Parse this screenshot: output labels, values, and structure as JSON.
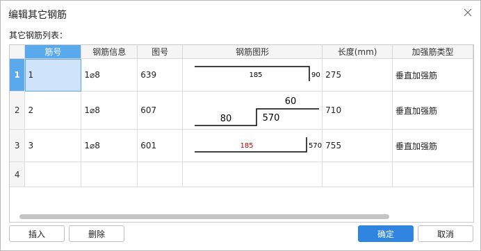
{
  "dialog": {
    "title": "编辑其它钢筋",
    "subtitle": "其它钢筋列表："
  },
  "table": {
    "columns": [
      "筋号",
      "钢筋信息",
      "图号",
      "钢筋图形",
      "长度(mm)",
      "加强筋类型"
    ],
    "rows": [
      {
        "row_no": "1",
        "bar_no": "1",
        "info": "1⌀8",
        "figure_no": "639",
        "shape_labels": [
          "185",
          "90"
        ],
        "length": "275",
        "type": "垂直加强筋"
      },
      {
        "row_no": "2",
        "bar_no": "2",
        "info": "1⌀8",
        "figure_no": "607",
        "shape_labels": [
          "60",
          "80",
          "570"
        ],
        "length": "710",
        "type": "垂直加强筋"
      },
      {
        "row_no": "3",
        "bar_no": "3",
        "info": "1⌀8",
        "figure_no": "601",
        "shape_labels": [
          "185",
          "570"
        ],
        "length": "755",
        "type": "垂直加强筋"
      },
      {
        "row_no": "4",
        "bar_no": "",
        "info": "",
        "figure_no": "",
        "shape_labels": [],
        "length": "",
        "type": ""
      }
    ]
  },
  "buttons": {
    "insert": "插入",
    "delete": "删除",
    "ok": "确定",
    "cancel": "取消"
  },
  "icons": {
    "close": "close-icon"
  },
  "colors": {
    "accent": "#2f85df",
    "selected_header": "#5aa9ec",
    "selected_cell": "#cfe3fa",
    "red_label": "#c00000"
  }
}
